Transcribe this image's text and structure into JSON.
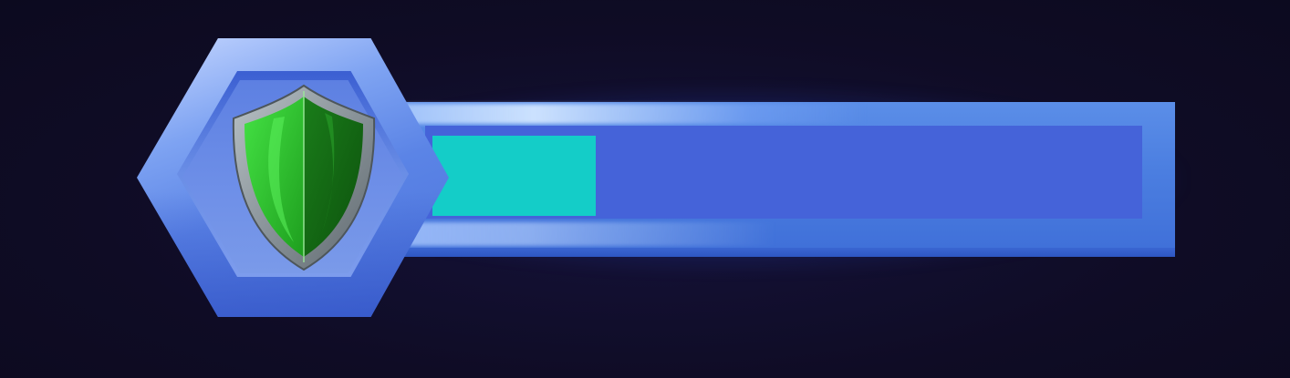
{
  "hud": {
    "stat_icon": "shield-icon",
    "bar": {
      "fill_fraction": 0.23,
      "fill_color": "#14cdc8",
      "track_color": "#4563d9",
      "frame_color": "#4b7ee0"
    },
    "badge": {
      "frame_color": "#5b84e6",
      "shield_color": "#22a322",
      "shield_rim_color": "#8a949a"
    },
    "background_color": "#0f0c24"
  }
}
